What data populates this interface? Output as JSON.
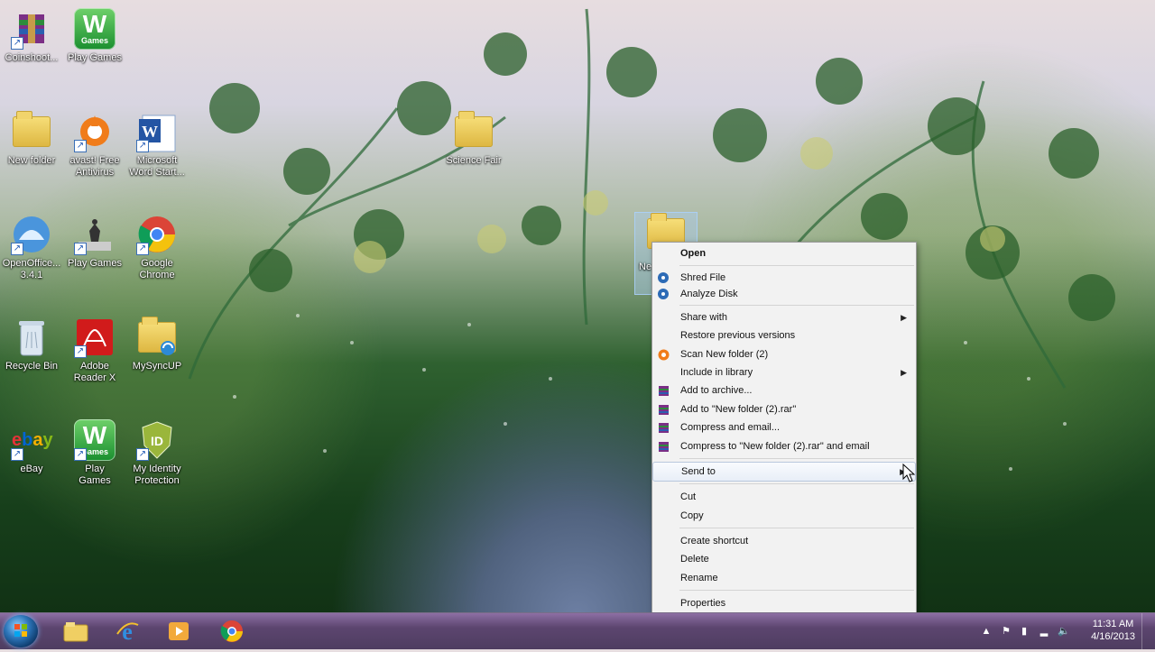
{
  "desktop": {
    "icons": [
      {
        "label": "Coinshoot...",
        "icon": "winrar-icon"
      },
      {
        "label": "Play Games",
        "icon": "wild-games-icon"
      },
      {
        "label": "New folder",
        "icon": "folder-icon"
      },
      {
        "label": "avast! Free\nAntivirus",
        "icon": "avast-icon"
      },
      {
        "label": "Microsoft\nWord Start...",
        "icon": "word-icon"
      },
      {
        "label": "Science Fair",
        "icon": "folder-icon"
      },
      {
        "label": "OpenOffice...\n3.4.1",
        "icon": "openoffice-icon"
      },
      {
        "label": "Play Games",
        "icon": "chess-icon"
      },
      {
        "label": "Google\nChrome",
        "icon": "chrome-icon"
      },
      {
        "label": "Recycle Bin",
        "icon": "recycle-bin-icon"
      },
      {
        "label": "Adobe\nReader X",
        "icon": "adobe-reader-icon"
      },
      {
        "label": "MySyncUP",
        "icon": "sync-folder-icon"
      },
      {
        "label": "eBay",
        "icon": "ebay-icon"
      },
      {
        "label": "Play\nGames",
        "icon": "wild-games-icon"
      },
      {
        "label": "My Identity\nProtection",
        "icon": "identity-shield-icon"
      }
    ],
    "selected_folder_label": "Ne"
  },
  "context_menu": {
    "items": [
      {
        "label": "Open",
        "bold": true
      },
      {
        "label": "Shred File",
        "icon": "shred-icon"
      },
      {
        "label": "Analyze Disk",
        "icon": "analyze-icon"
      },
      {
        "label": "Share with",
        "submenu": true
      },
      {
        "label": "Restore previous versions"
      },
      {
        "label": "Scan New folder (2)",
        "icon": "avast-scan-icon"
      },
      {
        "label": "Include in library",
        "submenu": true
      },
      {
        "label": "Add to archive...",
        "icon": "winrar-icon"
      },
      {
        "label": "Add to \"New folder (2).rar\"",
        "icon": "winrar-icon"
      },
      {
        "label": "Compress and email...",
        "icon": "winrar-icon"
      },
      {
        "label": "Compress to \"New folder (2).rar\" and email",
        "icon": "winrar-icon"
      },
      {
        "label": "Send to",
        "submenu": true,
        "highlight": true
      },
      {
        "label": "Cut"
      },
      {
        "label": "Copy"
      },
      {
        "label": "Create shortcut"
      },
      {
        "label": "Delete"
      },
      {
        "label": "Rename"
      },
      {
        "label": "Properties"
      }
    ]
  },
  "taskbar": {
    "pinned": [
      "explorer-icon",
      "internet-explorer-icon",
      "media-player-icon",
      "chrome-icon"
    ],
    "clock_time": "11:31 AM",
    "clock_date": "4/16/2013"
  }
}
